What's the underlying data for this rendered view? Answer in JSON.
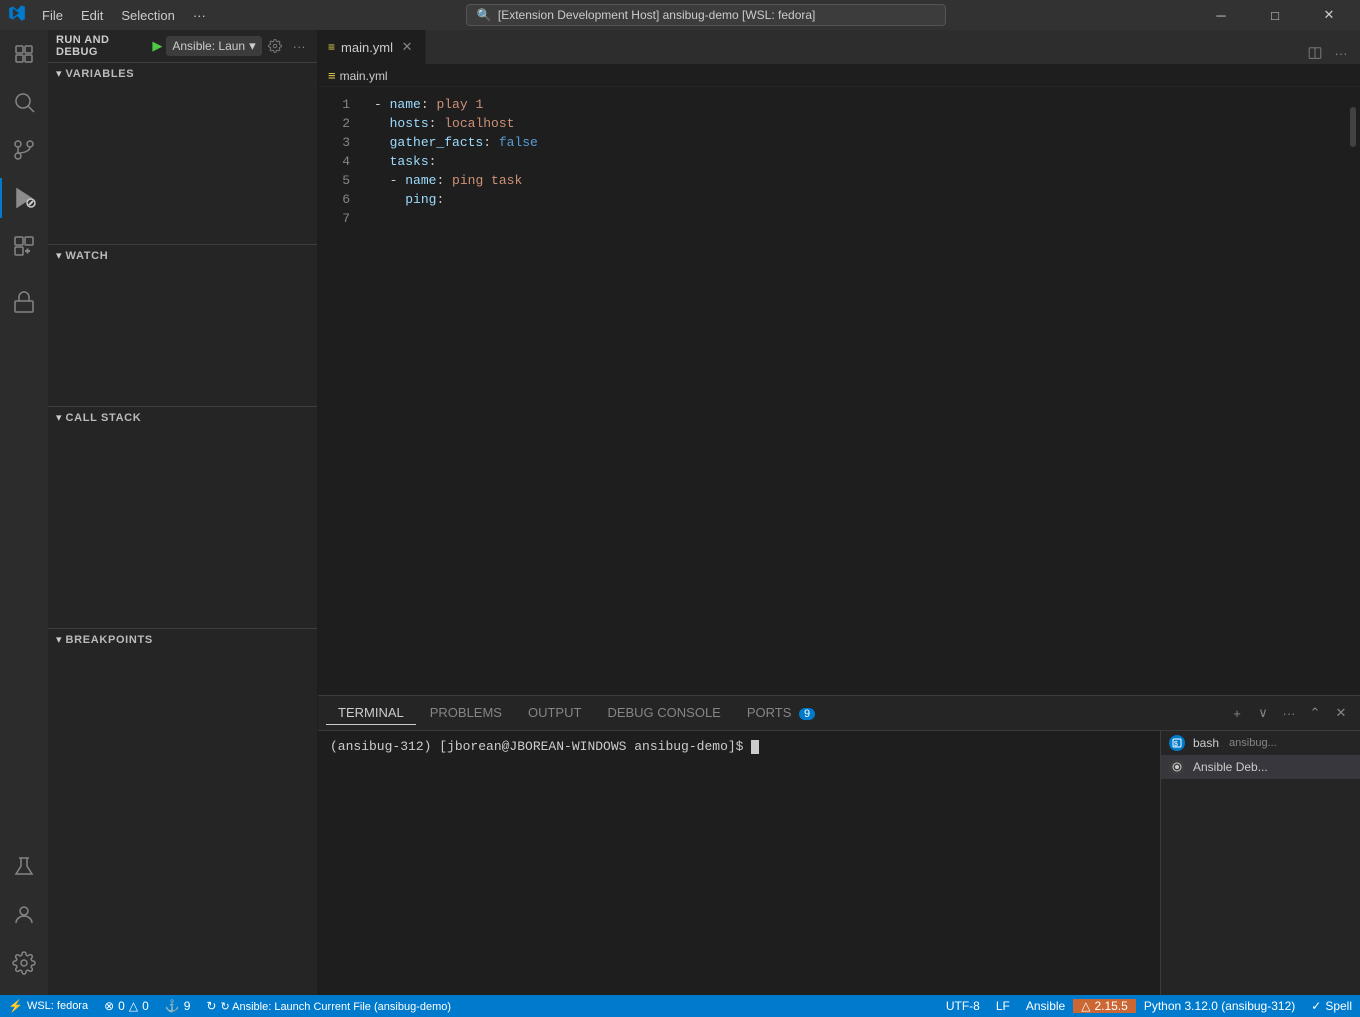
{
  "titlebar": {
    "logo": "VS",
    "menu": [
      "File",
      "Edit",
      "Selection",
      "···"
    ],
    "search_text": "[Extension Development Host] ansibug-demo [WSL: fedora]",
    "window_controls": [
      "─",
      "□",
      "×"
    ]
  },
  "activity_bar": {
    "items": [
      {
        "id": "explorer",
        "icon": "files-icon",
        "label": "Explorer"
      },
      {
        "id": "search",
        "icon": "search-icon",
        "label": "Search"
      },
      {
        "id": "source-control",
        "icon": "source-control-icon",
        "label": "Source Control"
      },
      {
        "id": "run-debug",
        "icon": "run-debug-icon",
        "label": "Run and Debug",
        "active": true
      },
      {
        "id": "extensions",
        "icon": "extensions-icon",
        "label": "Extensions"
      }
    ],
    "bottom": [
      {
        "id": "remote",
        "icon": "remote-icon",
        "label": "Remote"
      },
      {
        "id": "accounts",
        "icon": "accounts-icon",
        "label": "Accounts"
      },
      {
        "id": "settings",
        "icon": "settings-icon",
        "label": "Settings"
      }
    ]
  },
  "sidebar": {
    "debug_label": "RUN AND DEBUG",
    "config_name": "Ansible: Laun",
    "sections": {
      "variables": {
        "title": "VARIABLES",
        "collapsed": false
      },
      "watch": {
        "title": "WATCH",
        "collapsed": false
      },
      "call_stack": {
        "title": "CALL STACK",
        "collapsed": false
      },
      "breakpoints": {
        "title": "BREAKPOINTS",
        "collapsed": false
      }
    }
  },
  "editor": {
    "tab_name": "main.yml",
    "breadcrumb": "main.yml",
    "lines": [
      {
        "num": 1,
        "content": [
          {
            "type": "dash",
            "text": "- "
          },
          {
            "type": "key",
            "text": "name"
          },
          {
            "type": "colon",
            "text": ": "
          },
          {
            "type": "value",
            "text": "play 1"
          }
        ]
      },
      {
        "num": 2,
        "content": [
          {
            "type": "indent",
            "text": "  "
          },
          {
            "type": "key",
            "text": "hosts"
          },
          {
            "type": "colon",
            "text": ": "
          },
          {
            "type": "value",
            "text": "localhost"
          }
        ]
      },
      {
        "num": 3,
        "content": [
          {
            "type": "indent",
            "text": "  "
          },
          {
            "type": "key",
            "text": "gather_facts"
          },
          {
            "type": "colon",
            "text": ": "
          },
          {
            "type": "bool",
            "text": "false"
          }
        ]
      },
      {
        "num": 4,
        "content": [
          {
            "type": "indent",
            "text": "  "
          },
          {
            "type": "key",
            "text": "tasks"
          },
          {
            "type": "colon",
            "text": ":"
          }
        ]
      },
      {
        "num": 5,
        "content": [
          {
            "type": "indent",
            "text": "  "
          },
          {
            "type": "dash",
            "text": "- "
          },
          {
            "type": "key",
            "text": "name"
          },
          {
            "type": "colon",
            "text": ": "
          },
          {
            "type": "value",
            "text": "ping task"
          }
        ]
      },
      {
        "num": 6,
        "content": [
          {
            "type": "indent",
            "text": "    "
          },
          {
            "type": "key",
            "text": "ping"
          },
          {
            "type": "colon",
            "text": ":"
          }
        ]
      },
      {
        "num": 7,
        "content": []
      }
    ]
  },
  "terminal": {
    "tabs": [
      {
        "id": "terminal",
        "label": "TERMINAL",
        "active": true
      },
      {
        "id": "problems",
        "label": "PROBLEMS"
      },
      {
        "id": "output",
        "label": "OUTPUT"
      },
      {
        "id": "debug-console",
        "label": "DEBUG CONSOLE"
      },
      {
        "id": "ports",
        "label": "PORTS",
        "badge": "9"
      }
    ],
    "content": "(ansibug-312) [jborean@JBOREAN-WINDOWS ansibug-demo]$ ",
    "panels": [
      {
        "id": "bash",
        "label": "bash",
        "sublabel": "ansibug..."
      },
      {
        "id": "ansible-debug",
        "label": "Ansible Deb...",
        "active": true
      }
    ]
  },
  "status_bar": {
    "wsl": "⚡ WSL: fedora",
    "errors": "⊗ 0  △ 0",
    "ports": "⚓ 9",
    "debug": "↻ Ansible: Launch Current File (ansibug-demo)",
    "encoding": "UTF-8",
    "line_ending": "LF",
    "language": "Ansible",
    "warning": "△ 2.15.5",
    "python": "Python 3.12.0 (ansibug-312)",
    "spell": "✓ Spell"
  }
}
